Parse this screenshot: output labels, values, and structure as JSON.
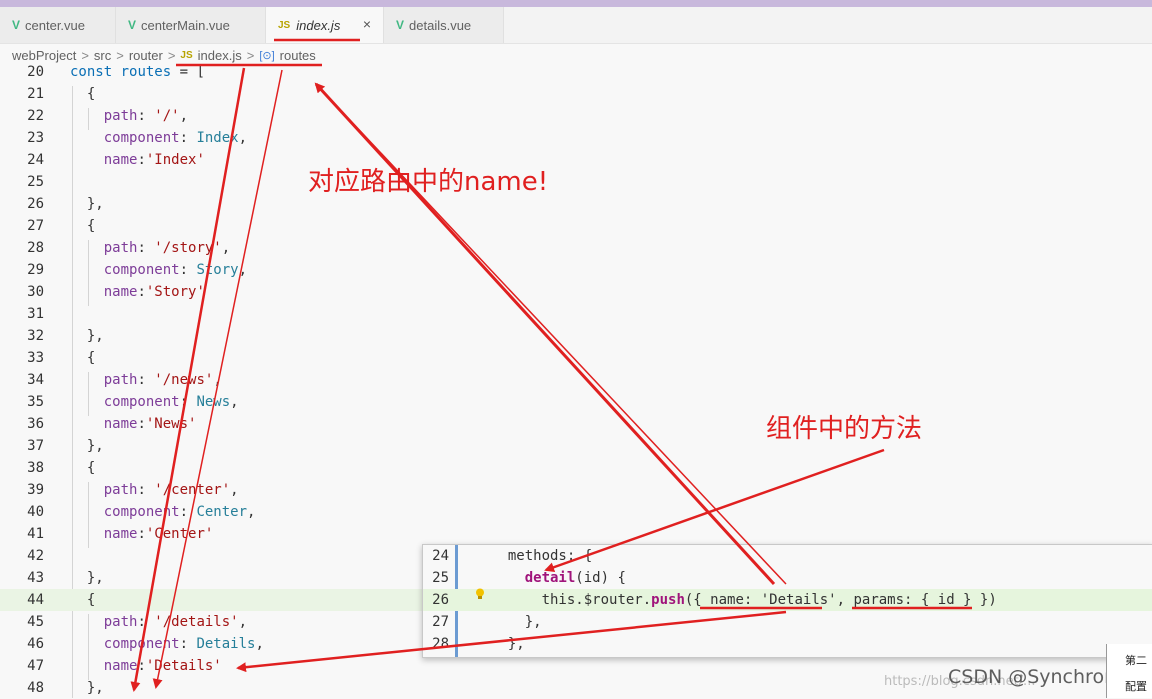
{
  "tabs": [
    {
      "icon": "vue-icon",
      "label": "center.vue"
    },
    {
      "icon": "vue-icon",
      "label": "centerMain.vue"
    },
    {
      "icon": "js-icon",
      "label": "index.js",
      "active": true,
      "close": "×"
    },
    {
      "icon": "vue-icon",
      "label": "details.vue"
    }
  ],
  "icons": {
    "vue": "V",
    "js": "JS",
    "symbol": "[⊙]"
  },
  "breadcrumb": {
    "items": [
      "webProject",
      "src",
      "router",
      "index.js",
      "routes"
    ],
    "sep": ">"
  },
  "code_lines": [
    {
      "n": "20",
      "text": "const routes = ["
    },
    {
      "n": "21",
      "text": "  {"
    },
    {
      "n": "22",
      "text": "    path: '/',"
    },
    {
      "n": "23",
      "text": "    component: Index,"
    },
    {
      "n": "24",
      "text": "    name:'Index'"
    },
    {
      "n": "25",
      "text": ""
    },
    {
      "n": "26",
      "text": "  },"
    },
    {
      "n": "27",
      "text": "  {"
    },
    {
      "n": "28",
      "text": "    path: '/story',"
    },
    {
      "n": "29",
      "text": "    component: Story,"
    },
    {
      "n": "30",
      "text": "    name:'Story'"
    },
    {
      "n": "31",
      "text": ""
    },
    {
      "n": "32",
      "text": "  },"
    },
    {
      "n": "33",
      "text": "  {"
    },
    {
      "n": "34",
      "text": "    path: '/news',"
    },
    {
      "n": "35",
      "text": "    component: News,"
    },
    {
      "n": "36",
      "text": "    name:'News'"
    },
    {
      "n": "37",
      "text": "  },"
    },
    {
      "n": "38",
      "text": "  {"
    },
    {
      "n": "39",
      "text": "    path: '/center',"
    },
    {
      "n": "40",
      "text": "    component: Center,"
    },
    {
      "n": "41",
      "text": "    name:'Center'"
    },
    {
      "n": "42",
      "text": ""
    },
    {
      "n": "43",
      "text": "  },"
    },
    {
      "n": "44",
      "text": "  {"
    },
    {
      "n": "45",
      "text": "    path: '/details',"
    },
    {
      "n": "46",
      "text": "    component: Details,"
    },
    {
      "n": "47",
      "text": "    name:'Details'"
    },
    {
      "n": "48",
      "text": "  },"
    }
  ],
  "popup_lines": [
    {
      "n": "24",
      "text": "  methods: {"
    },
    {
      "n": "25",
      "text": "    detail(id) {"
    },
    {
      "n": "26",
      "text": "      this.$router.push({ name: 'Details', params: { id } })"
    },
    {
      "n": "27",
      "text": "    },"
    },
    {
      "n": "28",
      "text": "  },"
    }
  ],
  "annotations": {
    "route_name": "对应路由中的name!",
    "component_method": "组件中的方法"
  },
  "watermark": "CSDN @Synchronize",
  "watermark_faint": "https://blog.csdn.net/...",
  "side_panel": [
    "第二",
    "配置"
  ],
  "colors": {
    "arrow": "#e02020",
    "vue": "#41b883",
    "js": "#b8a400"
  }
}
